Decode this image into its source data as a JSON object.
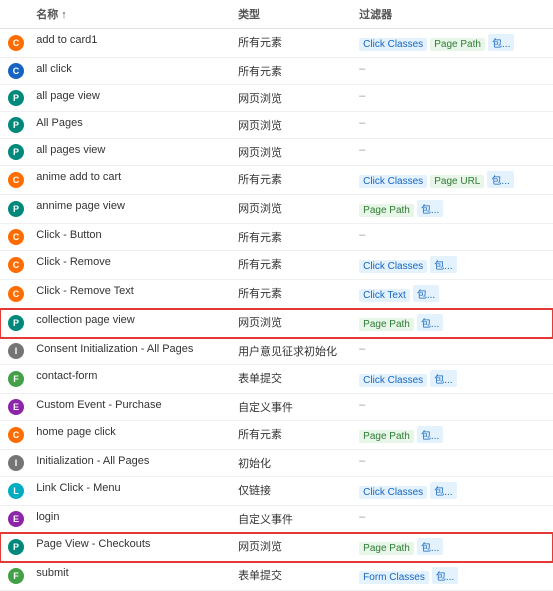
{
  "table": {
    "columns": [
      {
        "label": "",
        "key": "icon"
      },
      {
        "label": "名称 ↑",
        "key": "name"
      },
      {
        "label": "类型",
        "key": "type"
      },
      {
        "label": "过滤器",
        "key": "filters"
      }
    ],
    "rows": [
      {
        "name": "add to card1",
        "type": "所有元素",
        "filters": [
          {
            "text": "Click Classes",
            "color": "blue"
          },
          {
            "text": "Page Path",
            "color": "green"
          },
          {
            "text": "包...",
            "color": "blue"
          }
        ],
        "iconColor": "icon-orange",
        "iconLetter": "C",
        "highlighted": false
      },
      {
        "name": "all click",
        "type": "所有元素",
        "filters": [
          {
            "text": "–",
            "color": "dash"
          }
        ],
        "iconColor": "icon-blue",
        "iconLetter": "C",
        "highlighted": false
      },
      {
        "name": "all page view",
        "type": "网页浏览",
        "filters": [
          {
            "text": "–",
            "color": "dash"
          }
        ],
        "iconColor": "icon-teal",
        "iconLetter": "P",
        "highlighted": false
      },
      {
        "name": "All Pages",
        "type": "网页浏览",
        "filters": [
          {
            "text": "–",
            "color": "dash"
          }
        ],
        "iconColor": "icon-teal",
        "iconLetter": "P",
        "highlighted": false
      },
      {
        "name": "all pages view",
        "type": "网页浏览",
        "filters": [
          {
            "text": "–",
            "color": "dash"
          }
        ],
        "iconColor": "icon-teal",
        "iconLetter": "P",
        "highlighted": false
      },
      {
        "name": "anime add to cart",
        "type": "所有元素",
        "filters": [
          {
            "text": "Click Classes",
            "color": "blue"
          },
          {
            "text": "Page URL",
            "color": "green"
          },
          {
            "text": "包...",
            "color": "blue"
          }
        ],
        "iconColor": "icon-orange",
        "iconLetter": "C",
        "highlighted": false
      },
      {
        "name": "annime page view",
        "type": "网页浏览",
        "filters": [
          {
            "text": "Page Path",
            "color": "green"
          },
          {
            "text": "包...",
            "color": "blue"
          }
        ],
        "iconColor": "icon-teal",
        "iconLetter": "P",
        "highlighted": false
      },
      {
        "name": "Click - Button",
        "type": "所有元素",
        "filters": [
          {
            "text": "–",
            "color": "dash"
          }
        ],
        "iconColor": "icon-orange",
        "iconLetter": "C",
        "highlighted": false
      },
      {
        "name": "Click - Remove",
        "type": "所有元素",
        "filters": [
          {
            "text": "Click Classes",
            "color": "blue"
          },
          {
            "text": "包...",
            "color": "blue"
          }
        ],
        "iconColor": "icon-orange",
        "iconLetter": "C",
        "highlighted": false
      },
      {
        "name": "Click - Remove Text",
        "type": "所有元素",
        "filters": [
          {
            "text": "Click Text",
            "color": "blue"
          },
          {
            "text": "包...",
            "color": "blue"
          }
        ],
        "iconColor": "icon-orange",
        "iconLetter": "C",
        "highlighted": false
      },
      {
        "name": "collection page view",
        "type": "网页浏览",
        "filters": [
          {
            "text": "Page Path",
            "color": "green"
          },
          {
            "text": "包...",
            "color": "blue"
          }
        ],
        "iconColor": "icon-teal",
        "iconLetter": "P",
        "highlighted": true
      },
      {
        "name": "Consent Initialization - All Pages",
        "type": "用户意见征求初始化",
        "filters": [
          {
            "text": "–",
            "color": "dash"
          }
        ],
        "iconColor": "icon-gray",
        "iconLetter": "I",
        "highlighted": false
      },
      {
        "name": "contact-form",
        "type": "表单提交",
        "filters": [
          {
            "text": "Click Classes",
            "color": "blue"
          },
          {
            "text": "包...",
            "color": "blue"
          }
        ],
        "iconColor": "icon-green",
        "iconLetter": "F",
        "highlighted": false
      },
      {
        "name": "Custom Event - Purchase",
        "type": "自定义事件",
        "filters": [
          {
            "text": "–",
            "color": "dash"
          }
        ],
        "iconColor": "icon-purple",
        "iconLetter": "E",
        "highlighted": false
      },
      {
        "name": "home page click",
        "type": "所有元素",
        "filters": [
          {
            "text": "Page Path",
            "color": "green"
          },
          {
            "text": "包...",
            "color": "blue"
          }
        ],
        "iconColor": "icon-orange",
        "iconLetter": "C",
        "highlighted": false
      },
      {
        "name": "Initialization - All Pages",
        "type": "初始化",
        "filters": [
          {
            "text": "–",
            "color": "dash"
          }
        ],
        "iconColor": "icon-gray",
        "iconLetter": "I",
        "highlighted": false
      },
      {
        "name": "Link Click - Menu",
        "type": "仅链接",
        "filters": [
          {
            "text": "Click Classes",
            "color": "blue"
          },
          {
            "text": "包...",
            "color": "blue"
          }
        ],
        "iconColor": "icon-cyan",
        "iconLetter": "L",
        "highlighted": false
      },
      {
        "name": "login",
        "type": "自定义事件",
        "filters": [
          {
            "text": "–",
            "color": "dash"
          }
        ],
        "iconColor": "icon-purple",
        "iconLetter": "E",
        "highlighted": false
      },
      {
        "name": "Page View - Checkouts",
        "type": "网页浏览",
        "filters": [
          {
            "text": "Page Path",
            "color": "green"
          },
          {
            "text": "包...",
            "color": "blue"
          }
        ],
        "iconColor": "icon-teal",
        "iconLetter": "P",
        "highlighted": true
      },
      {
        "name": "submit",
        "type": "表单提交",
        "filters": [
          {
            "text": "Form Classes",
            "color": "blue"
          },
          {
            "text": "包...",
            "color": "blue"
          }
        ],
        "iconColor": "icon-green",
        "iconLetter": "F",
        "highlighted": false
      }
    ]
  }
}
